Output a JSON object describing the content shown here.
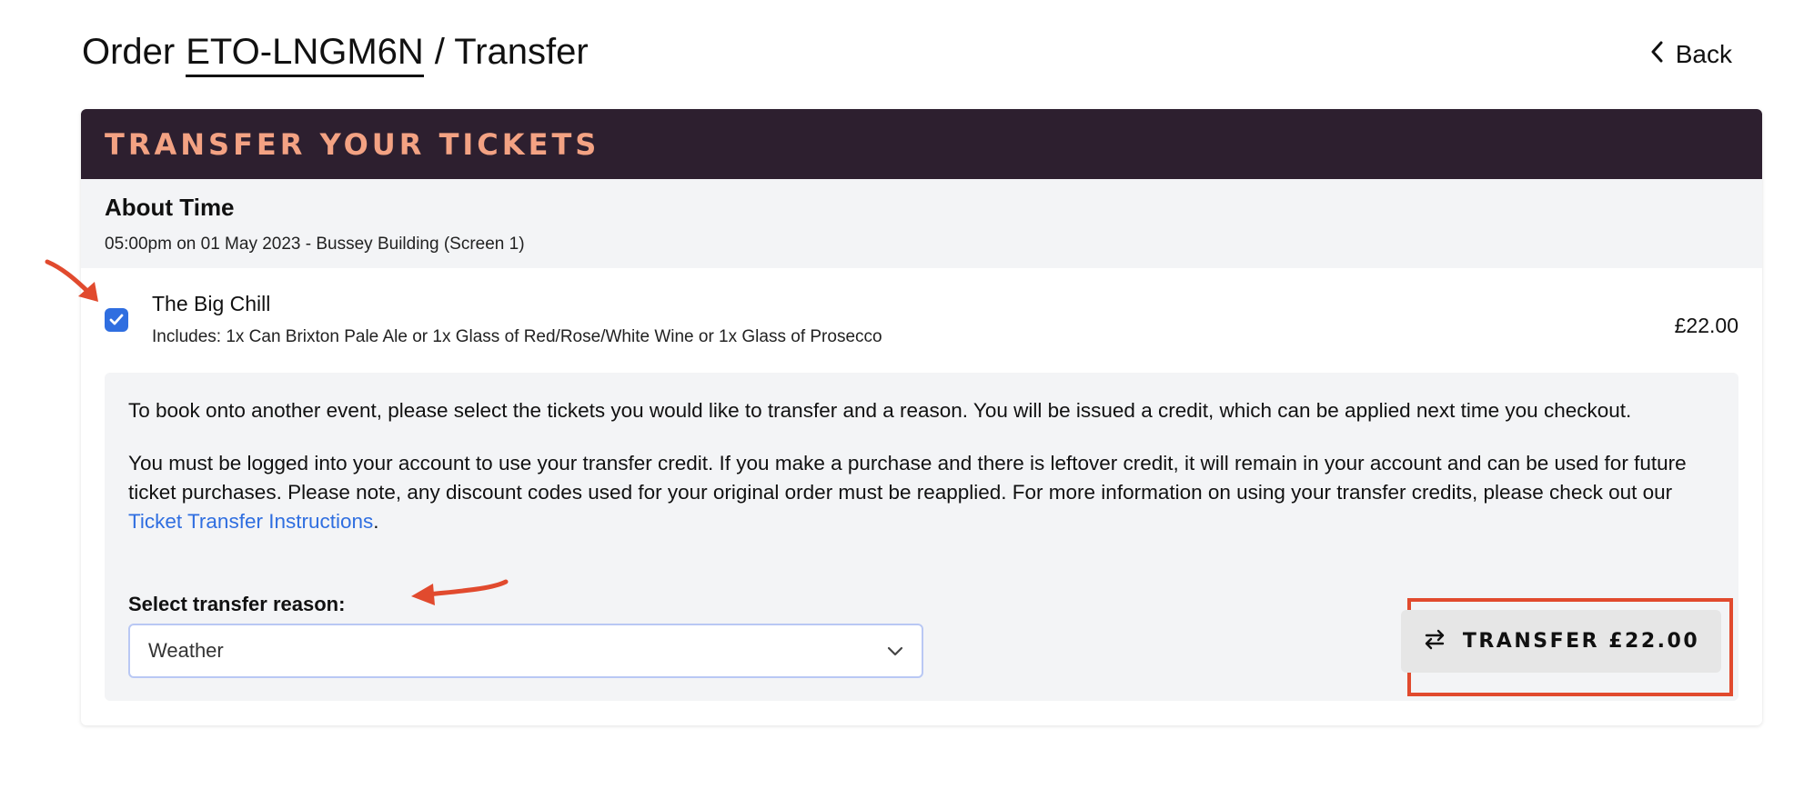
{
  "header": {
    "order_prefix": "Order",
    "order_id": "ETO-LNGM6N",
    "suffix": "/ Transfer",
    "back_label": "Back"
  },
  "card": {
    "title": "TRANSFER YOUR TICKETS",
    "event_title": "About Time",
    "event_meta": "05:00pm on 01 May 2023 - Bussey Building (Screen 1)"
  },
  "ticket": {
    "name": "The Big Chill",
    "includes": "Includes: 1x Can Brixton Pale Ale or 1x Glass of Red/Rose/White Wine or 1x Glass of Prosecco",
    "price": "£22.00",
    "checked": true
  },
  "transfer": {
    "paragraph1": "To book onto another event, please select the tickets you would like to transfer and a reason. You will be issued a credit, which can be applied next time you checkout.",
    "paragraph2_start": "You must be logged into your account to use your transfer credit. If you make a purchase and there is leftover credit, it will remain in your account and can be used for future ticket purchases. Please note, any discount codes used for your original order must be reapplied. For more information on using your transfer credits, please check out our ",
    "link_text": "Ticket Transfer Instructions",
    "paragraph2_end": ".",
    "reason_label": "Select transfer reason:",
    "reason_value": "Weather",
    "button_label": "TRANSFER £22.00"
  },
  "colors": {
    "header_bg": "#2d1f2f",
    "header_text": "#f3a283",
    "accent_blue": "#2f6ee0",
    "annotation_red": "#e14a2e"
  }
}
